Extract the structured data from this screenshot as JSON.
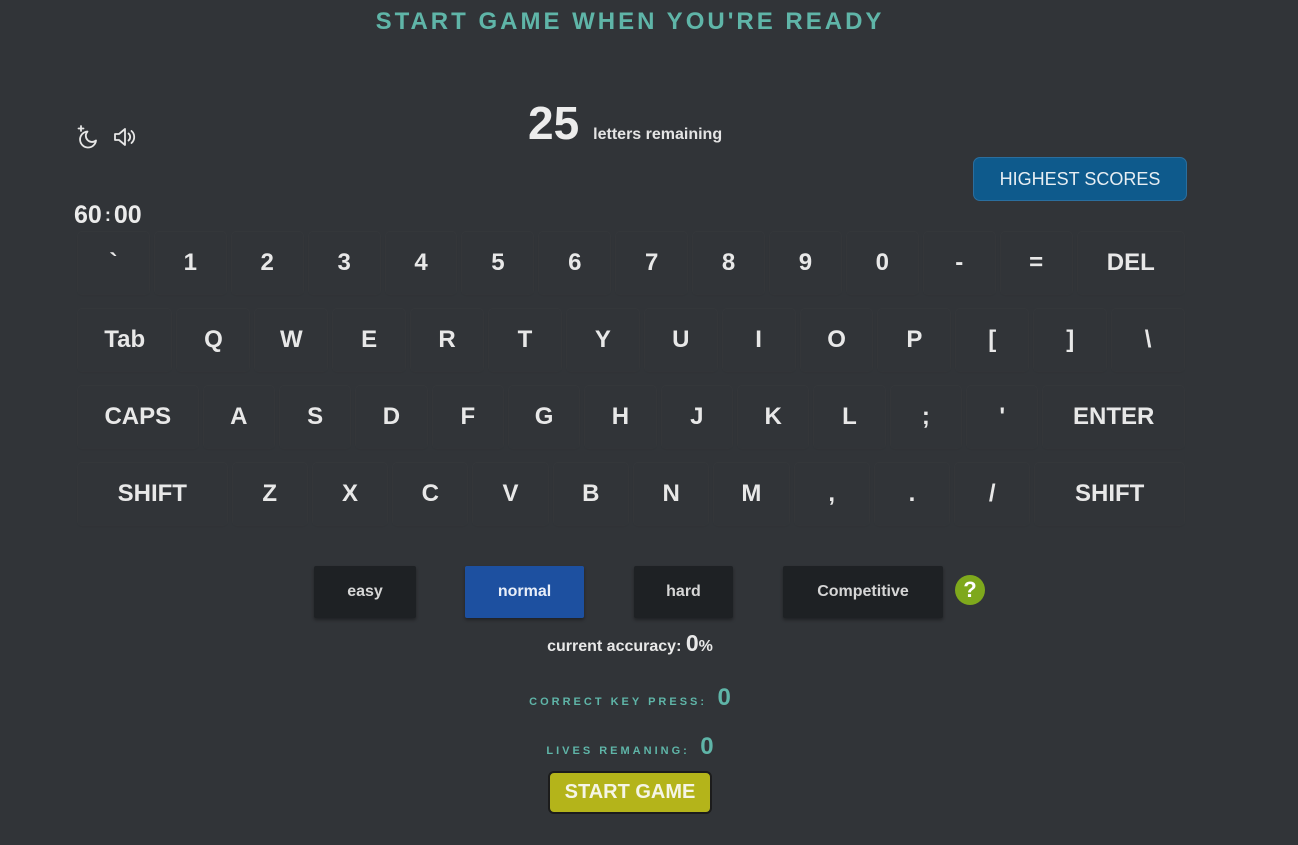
{
  "header": {
    "title": "START GAME WHEN YOU'RE READY"
  },
  "toggles": {
    "theme_icon": "moon-sparkle-icon",
    "sound_icon": "speaker-icon"
  },
  "counter": {
    "value": "25",
    "label": "letters remaining"
  },
  "highscores": {
    "label": "HIGHEST SCORES"
  },
  "timer": {
    "minutes": "60",
    "separator": ":",
    "seconds": "00"
  },
  "keyboard": {
    "rows": [
      [
        "`",
        "1",
        "2",
        "3",
        "4",
        "5",
        "6",
        "7",
        "8",
        "9",
        "0",
        "-",
        "=",
        "DEL"
      ],
      [
        "Tab",
        "Q",
        "W",
        "E",
        "R",
        "T",
        "Y",
        "U",
        "I",
        "O",
        "P",
        "[",
        "]",
        "\\"
      ],
      [
        "CAPS",
        "A",
        "S",
        "D",
        "F",
        "G",
        "H",
        "J",
        "K",
        "L",
        ";",
        "'",
        "ENTER"
      ],
      [
        "SHIFT",
        "Z",
        "X",
        "C",
        "V",
        "B",
        "N",
        "M",
        ",",
        ".",
        "/",
        "SHIFT"
      ]
    ]
  },
  "difficulty": {
    "options": [
      "easy",
      "normal",
      "hard",
      "Competitive"
    ],
    "selected": "normal",
    "help_label": "?"
  },
  "accuracy": {
    "label": "current accuracy:",
    "value": "0",
    "unit": "%"
  },
  "stats": {
    "correct": {
      "label": "CORRECT KEY PRESS:",
      "value": "0"
    },
    "lives": {
      "label": "LIVES REMANING:",
      "value": "0"
    }
  },
  "start": {
    "label": "START GAME"
  },
  "colors": {
    "background": "#313438",
    "teal_accent": "#5fb5a8",
    "highscore_button": "#0e5a8c",
    "selected_difficulty": "#1d50a0",
    "start_button": "#b4b41a",
    "help": "#7ea81c"
  }
}
